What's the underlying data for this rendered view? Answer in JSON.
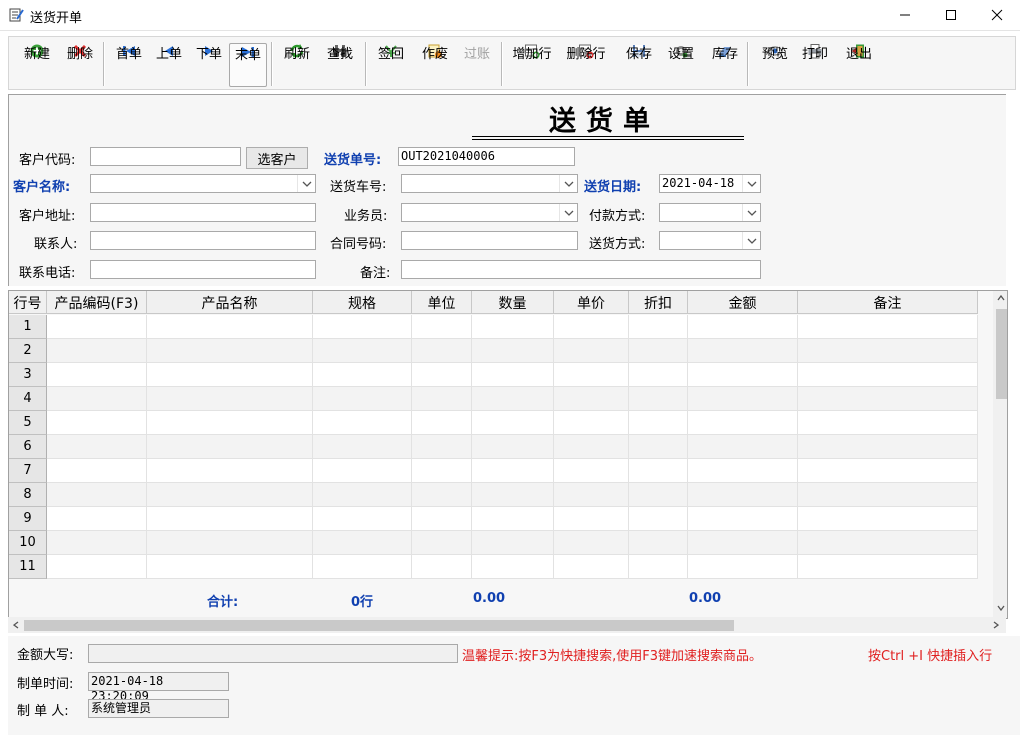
{
  "window": {
    "title": "送货开单",
    "icons": {
      "app": "notepad-edit-icon",
      "minimize": "minimize-icon",
      "maximize": "maximize-icon",
      "close": "close-icon"
    }
  },
  "toolbar": {
    "new": "新建",
    "delete": "删除",
    "first": "首单",
    "prev": "上单",
    "next": "下单",
    "last": "末单",
    "refresh": "刷新",
    "find": "查找",
    "signback": "签回",
    "void": "作废",
    "post": "过账",
    "add_row": "增加行",
    "delete_row": "删除行",
    "save": "保存",
    "settings": "设置",
    "stock": "库存",
    "preview": "预览",
    "print": "打印",
    "exit": "退出"
  },
  "form": {
    "doc_title": "送货单",
    "customer_code_label": "客户代码:",
    "customer_code_value": "",
    "choose_customer": "选客户",
    "order_no_label": "送货单号:",
    "order_no_value": "OUT2021040006",
    "customer_name_label": "客户名称:",
    "vehicle_label": "送货车号:",
    "date_label": "送货日期:",
    "date_value": "2021-04-18",
    "address_label": "客户地址:",
    "salesman_label": "业务员:",
    "payment_label": "付款方式:",
    "contact_label": "联系人:",
    "contract_label": "合同号码:",
    "delivery_method_label": "送货方式:",
    "phone_label": "联系电话:",
    "remark_label": "备注:"
  },
  "grid": {
    "columns": [
      "行号",
      "产品编码(F3)",
      "产品名称",
      "规格",
      "单位",
      "数量",
      "单价",
      "折扣",
      "金额",
      "备注"
    ],
    "rows": [
      "1",
      "2",
      "3",
      "4",
      "5",
      "6",
      "7",
      "8",
      "9",
      "10",
      "11"
    ],
    "totals": {
      "label": "合计:",
      "rows": "0行",
      "quantity": "0.00",
      "amount": "0.00"
    }
  },
  "footer": {
    "amount_words_label": "金额大写:",
    "hint1": "温馨提示:按F3为快捷搜索,使用F3键加速搜索商品。",
    "hint2": "按Ctrl +I 快捷插入行",
    "created_time_label": "制单时间:",
    "created_time_value": "2021-04-18 23:20:09",
    "creator_label": "制 单 人:",
    "creator_value": "系统管理员"
  },
  "colors": {
    "label_blue": "#1040b0",
    "hint_red": "#e02020"
  }
}
